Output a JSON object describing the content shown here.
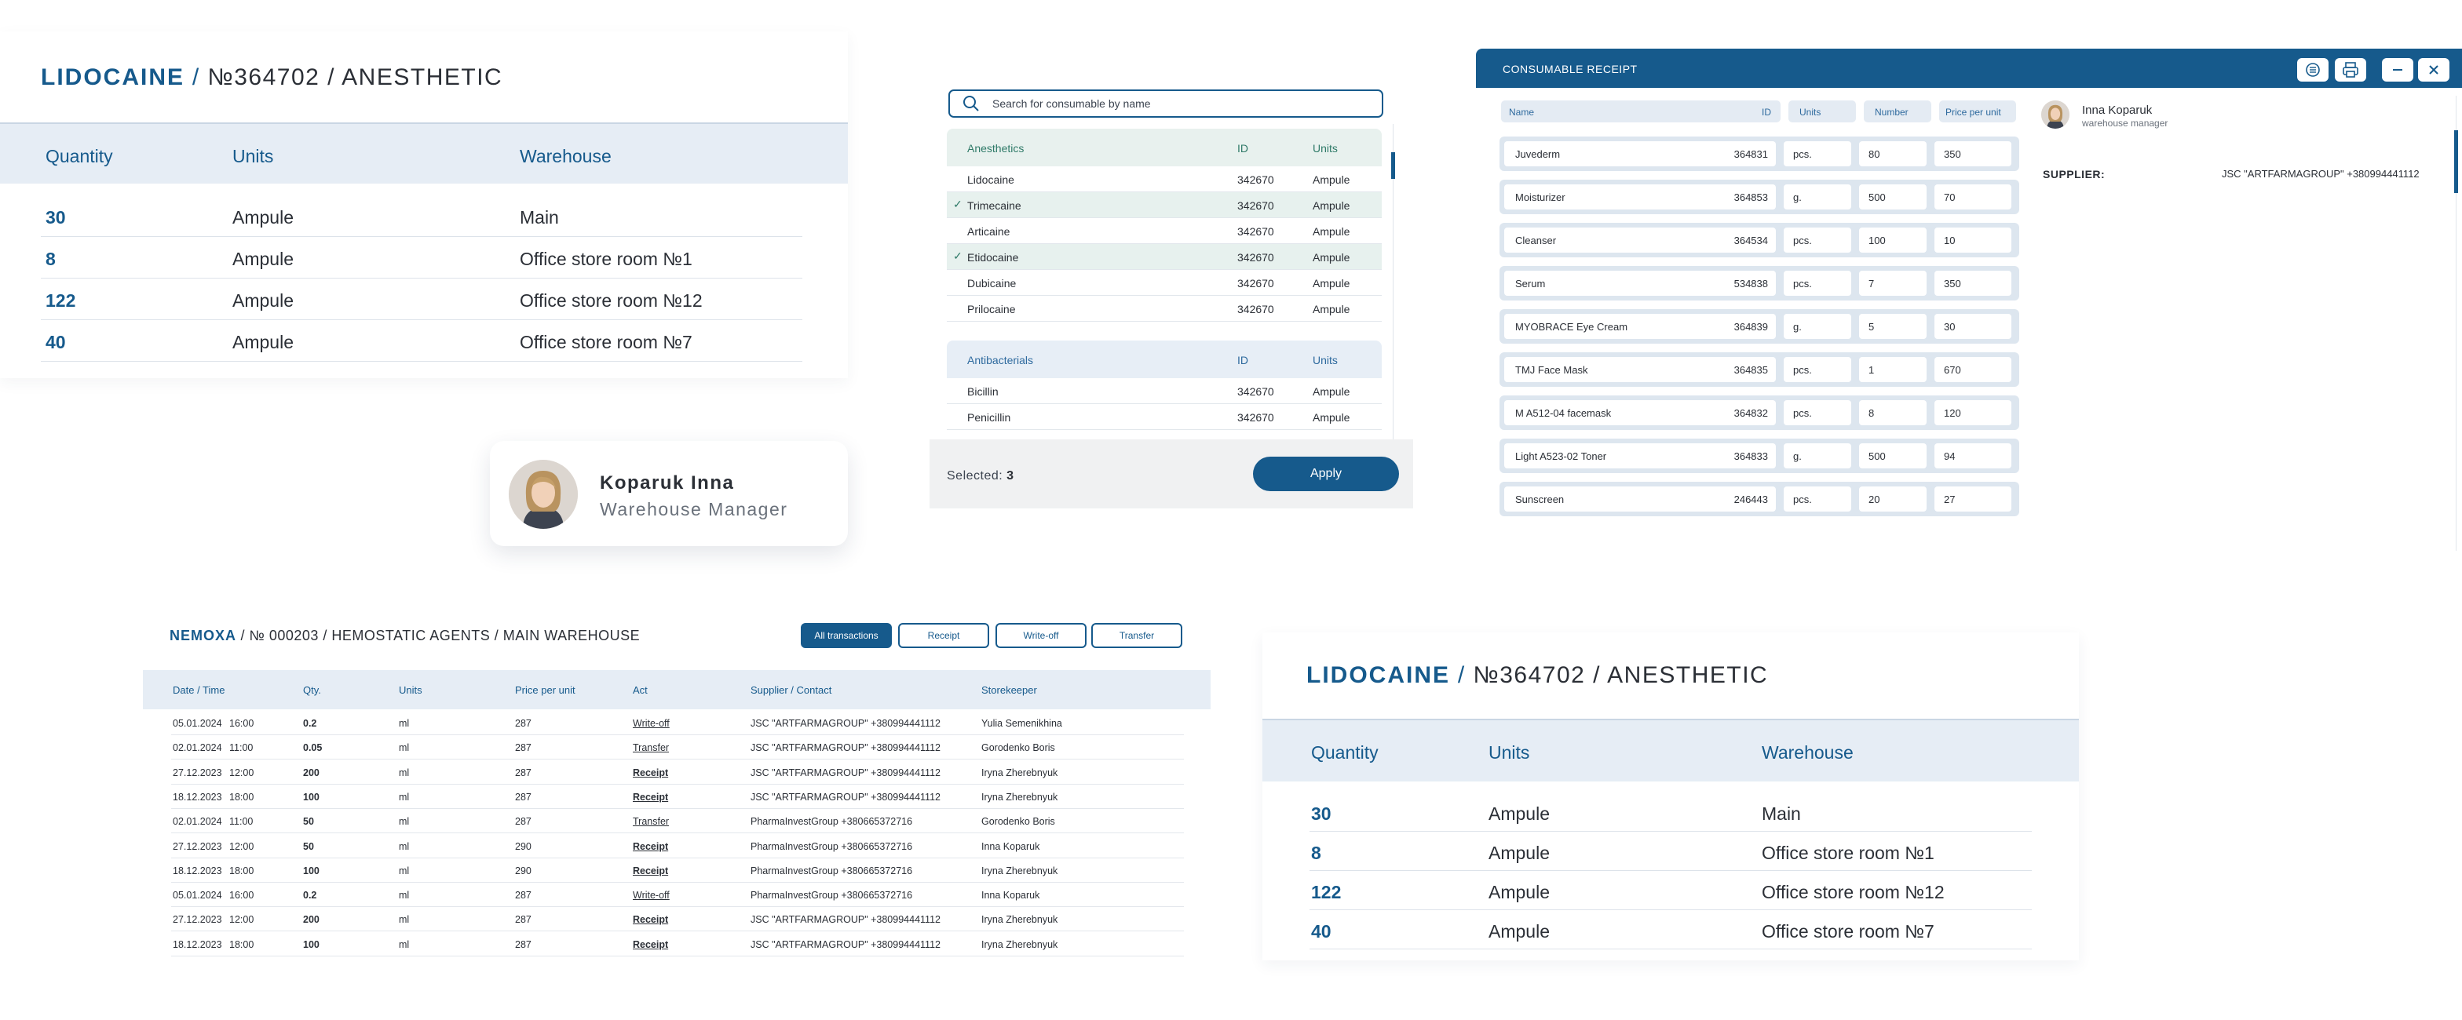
{
  "stock_card": {
    "product": "LIDOCAINE",
    "separator": "/",
    "rest": "№364702 / ANESTHETIC",
    "headers": [
      "Quantity",
      "Units",
      "Warehouse"
    ],
    "rows": [
      {
        "qty": "30",
        "units": "Ampule",
        "warehouse": "Main"
      },
      {
        "qty": "8",
        "units": "Ampule",
        "warehouse": "Office store room №1"
      },
      {
        "qty": "122",
        "units": "Ampule",
        "warehouse": "Office store room №12"
      },
      {
        "qty": "40",
        "units": "Ampule",
        "warehouse": "Office store room №7"
      }
    ]
  },
  "profile": {
    "name": "Koparuk Inna",
    "role": "Warehouse Manager"
  },
  "selector": {
    "search_placeholder": "Search for consumable by name",
    "groups": [
      {
        "name": "Anesthetics",
        "id_label": "ID",
        "units_label": "Units",
        "items": [
          {
            "name": "Lidocaine",
            "id": "342670",
            "units": "Ampule",
            "selected": false
          },
          {
            "name": "Trimecaine",
            "id": "342670",
            "units": "Ampule",
            "selected": true
          },
          {
            "name": "Articaine",
            "id": "342670",
            "units": "Ampule",
            "selected": false
          },
          {
            "name": "Etidocaine",
            "id": "342670",
            "units": "Ampule",
            "selected": true
          },
          {
            "name": "Dubicaine",
            "id": "342670",
            "units": "Ampule",
            "selected": false
          },
          {
            "name": "Prilocaine",
            "id": "342670",
            "units": "Ampule",
            "selected": false
          }
        ]
      },
      {
        "name": "Antibacterials",
        "id_label": "ID",
        "units_label": "Units",
        "items": [
          {
            "name": "Bicillin",
            "id": "342670",
            "units": "Ampule",
            "selected": false
          },
          {
            "name": "Penicillin",
            "id": "342670",
            "units": "Ampule",
            "selected": false
          }
        ]
      }
    ],
    "selected_label": "Selected:",
    "selected_count": "3",
    "apply_label": "Apply"
  },
  "receipt": {
    "title": "CONSUMABLE RECEIPT",
    "columns": {
      "name": "Name",
      "id": "ID",
      "units": "Units",
      "number": "Number",
      "price": "Price per unit"
    },
    "rows": [
      {
        "name": "Juvederm",
        "id": "364831",
        "units": "pcs.",
        "number": "80",
        "price": "350"
      },
      {
        "name": "Moisturizer",
        "id": "364853",
        "units": "g.",
        "number": "500",
        "price": "70"
      },
      {
        "name": "Cleanser",
        "id": "364534",
        "units": "pcs.",
        "number": "100",
        "price": "10"
      },
      {
        "name": "Serum",
        "id": "534838",
        "units": "pcs.",
        "number": "7",
        "price": "350"
      },
      {
        "name": "MYOBRACE Eye Cream",
        "id": "364839",
        "units": "g.",
        "number": "5",
        "price": "30"
      },
      {
        "name": "TMJ Face Mask",
        "id": "364835",
        "units": "pcs.",
        "number": "1",
        "price": "670"
      },
      {
        "name": "M A512-04 facemask",
        "id": "364832",
        "units": "pcs.",
        "number": "8",
        "price": "120"
      },
      {
        "name": "Light A523-02 Toner",
        "id": "364833",
        "units": "g.",
        "number": "500",
        "price": "94"
      },
      {
        "name": "Sunscreen",
        "id": "246443",
        "units": "pcs.",
        "number": "20",
        "price": "27"
      }
    ],
    "person_name": "Inna Koparuk",
    "person_role": "warehouse manager",
    "supplier_label": "SUPPLIER:",
    "supplier_value": "JSC \"ARTFARMAGROUP\" +380994441112"
  },
  "transactions": {
    "product": "NEMOXA",
    "rest": "/ № 000203 / HEMOSTATIC AGENTS / MAIN WAREHOUSE",
    "buttons": [
      "All transactions",
      "Receipt",
      "Write-off",
      "Transfer"
    ],
    "headers": [
      "Date / Time",
      "Qty.",
      "Units",
      "Price per unit",
      "Act",
      "Supplier / Contact",
      "Storekeeper"
    ],
    "rows": [
      {
        "date": "05.01.2024",
        "time": "16:00",
        "qty": "0.2",
        "units": "ml",
        "price": "287",
        "act": "Write-off",
        "kind": "writeoff",
        "supplier": "JSC \"ARTFARMAGROUP\" +380994441112",
        "keeper": "Yulia Semenikhina"
      },
      {
        "date": "02.01.2024",
        "time": "11:00",
        "qty": "0.05",
        "units": "ml",
        "price": "287",
        "act": "Transfer",
        "kind": "transfer",
        "supplier": "JSC \"ARTFARMAGROUP\" +380994441112",
        "keeper": "Gorodenko Boris"
      },
      {
        "date": "27.12.2023",
        "time": "12:00",
        "qty": "200",
        "units": "ml",
        "price": "287",
        "act": "Receipt",
        "kind": "receipt",
        "supplier": "JSC \"ARTFARMAGROUP\" +380994441112",
        "keeper": "Iryna Zherebnyuk"
      },
      {
        "date": "18.12.2023",
        "time": "18:00",
        "qty": "100",
        "units": "ml",
        "price": "287",
        "act": "Receipt",
        "kind": "receipt",
        "supplier": "JSC \"ARTFARMAGROUP\" +380994441112",
        "keeper": "Iryna Zherebnyuk"
      },
      {
        "date": "02.01.2024",
        "time": "11:00",
        "qty": "50",
        "units": "ml",
        "price": "287",
        "act": "Transfer",
        "kind": "transfer",
        "supplier": "PharmaInvestGroup  +380665372716",
        "keeper": "Gorodenko Boris"
      },
      {
        "date": "27.12.2023",
        "time": "12:00",
        "qty": "50",
        "units": "ml",
        "price": "290",
        "act": "Receipt",
        "kind": "receipt",
        "supplier": "PharmaInvestGroup  +380665372716",
        "keeper": "Inna Koparuk"
      },
      {
        "date": "18.12.2023",
        "time": "18:00",
        "qty": "100",
        "units": "ml",
        "price": "290",
        "act": "Receipt",
        "kind": "receipt",
        "supplier": "PharmaInvestGroup  +380665372716",
        "keeper": "Iryna Zherebnyuk"
      },
      {
        "date": "05.01.2024",
        "time": "16:00",
        "qty": "0.2",
        "units": "ml",
        "price": "287",
        "act": "Write-off",
        "kind": "writeoff",
        "supplier": "PharmaInvestGroup  +380665372716",
        "keeper": "Inna Koparuk"
      },
      {
        "date": "27.12.2023",
        "time": "12:00",
        "qty": "200",
        "units": "ml",
        "price": "287",
        "act": "Receipt",
        "kind": "receipt",
        "supplier": "JSC \"ARTFARMAGROUP\" +380994441112",
        "keeper": "Iryna Zherebnyuk"
      },
      {
        "date": "18.12.2023",
        "time": "18:00",
        "qty": "100",
        "units": "ml",
        "price": "287",
        "act": "Receipt",
        "kind": "receipt",
        "supplier": "JSC \"ARTFARMAGROUP\" +380994441112",
        "keeper": "Iryna Zherebnyuk"
      }
    ]
  },
  "colors": {
    "brand": "#165a8c",
    "header_bg": "#e6edf5",
    "write_off": "#d9534f",
    "transfer": "#3f8fd2",
    "selected_row": "#e7f1ee"
  },
  "icons": [
    "search-icon",
    "check-icon",
    "list-icon",
    "print-icon",
    "minimize-icon",
    "close-icon"
  ]
}
